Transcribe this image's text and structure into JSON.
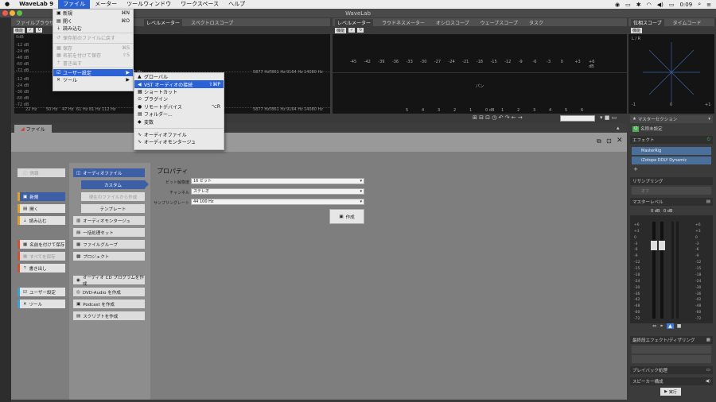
{
  "menubar": {
    "app": "WaveLab 9",
    "items": [
      "ファイル",
      "メーター",
      "ツールウィンドウ",
      "ワークスペース",
      "ヘルプ"
    ],
    "active": "ファイル",
    "time": "0:09"
  },
  "window": {
    "title": "WaveLab"
  },
  "panels": {
    "left_tabs": [
      "ファイルブラウザー",
      "レベルメーター",
      "スペクトロスコープ"
    ],
    "center_tabs": [
      "レベルメーター",
      "ラウドネスメーター",
      "オシロスコープ",
      "ウェーブスコープ",
      "タスク"
    ],
    "right_tabs": [
      "位相スコープ",
      "タイムコード"
    ],
    "mode_label": "機能",
    "phase_label": "L / R",
    "phase_scale": [
      "-1",
      "0",
      "+1"
    ]
  },
  "spectro": {
    "db_labels": [
      "0dB",
      "-12 dB",
      "-24 dB",
      "-48 dB",
      "-60 dB",
      "-72 dB",
      "-84 dB"
    ],
    "hz_labels": [
      "22 Hz",
      "31 Hz",
      "50 Hz",
      "1 Hz",
      "89 Hz",
      "112 Hz",
      "2 Hz",
      "3Hz",
      "23 Hz",
      "2 Hz",
      "4 Hz",
      "5877 Hz",
      "7861 Hz",
      "9164 Hz",
      "14080 Hz"
    ],
    "db_labels2": [
      "0dB",
      "-12 dB",
      "-24 dB",
      "-36 dB",
      "-48 dB",
      "-60 dB",
      "-72 dB",
      "-84 dB"
    ],
    "hz_labels2": [
      "22 Hz",
      "31 Hz",
      "50 Hz",
      "47 Hz",
      "61 Hz",
      "81 Hz",
      "112 Hz",
      "153 Hz",
      "2 Hz",
      "3 Hz",
      "4 Hz",
      "5877 Hz",
      "7861 Hz",
      "9164 Hz",
      "14080 Hz"
    ]
  },
  "level_meter": {
    "scale": [
      "-45",
      "-42",
      "-39",
      "-36",
      "-33",
      "-30",
      "-27",
      "-24",
      "-21",
      "-18",
      "-15",
      "-12",
      "-9",
      "-6",
      "-3",
      "0",
      "+3",
      "+6 dB"
    ],
    "pan_label": "パン",
    "pan_scale": [
      "5",
      "4",
      "3",
      "2",
      "1",
      "0 dB",
      "1",
      "2",
      "3",
      "4",
      "5",
      "6"
    ]
  },
  "file_menu": {
    "items": [
      {
        "icon": "new",
        "label": "新規",
        "shortcut": "⌘N",
        "disabled": false
      },
      {
        "icon": "open",
        "label": "開く",
        "shortcut": "⌘O",
        "disabled": false
      },
      {
        "icon": "import",
        "label": "読み込む",
        "shortcut": "",
        "disabled": false
      },
      {
        "icon": "revert",
        "label": "保存前のファイルに戻す",
        "shortcut": "",
        "disabled": true
      },
      {
        "icon": "save",
        "label": "保存",
        "shortcut": "⌘S",
        "disabled": true
      },
      {
        "icon": "saveas",
        "label": "名前を付けて保存",
        "shortcut": "⇧S",
        "disabled": true
      },
      {
        "icon": "export",
        "label": "書き出す",
        "shortcut": "",
        "disabled": true
      },
      {
        "icon": "prefs",
        "label": "ユーザー設定",
        "shortcut": "▶",
        "disabled": false,
        "highlight": true
      },
      {
        "icon": "tools",
        "label": "ツール",
        "shortcut": "▶",
        "disabled": false
      }
    ]
  },
  "prefs_submenu": {
    "items": [
      {
        "label": "グローバル",
        "shortcut": ""
      },
      {
        "label": "VST オーディオの接続",
        "shortcut": "⇧⌘P",
        "highlight": true
      },
      {
        "label": "ショートカット",
        "shortcut": ""
      },
      {
        "label": "プラグイン",
        "shortcut": ""
      },
      {
        "label": "リモートデバイス",
        "shortcut": "⌥R"
      },
      {
        "label": "フォルダー...",
        "shortcut": ""
      },
      {
        "label": "変数",
        "shortcut": ""
      },
      {
        "label": "オーディオファイル",
        "shortcut": ""
      },
      {
        "label": "オーディオモンタージュ",
        "shortcut": ""
      }
    ]
  },
  "file_tab": {
    "label": "ファイル"
  },
  "left_nav": {
    "items": [
      {
        "label": "情報",
        "disabled": true,
        "color": ""
      },
      {
        "label": "新規",
        "selected": true,
        "color": "#e0a020"
      },
      {
        "label": "開く",
        "color": "#e0a020"
      },
      {
        "label": "読み込む",
        "color": "#e0a020"
      },
      {
        "label": "名前を付けて保存",
        "color": "#d05030"
      },
      {
        "label": "すべてを保存",
        "disabled": true,
        "color": "#d05030"
      },
      {
        "label": "書き出し",
        "color": "#d05030"
      },
      {
        "label": "ユーザー設定",
        "color": "#3aa0d0"
      },
      {
        "label": "ツール",
        "color": "#3aa0d0"
      }
    ]
  },
  "mid_nav": {
    "audio_file": "オーディオファイル",
    "custom": "カスタム",
    "from_current": "現在のファイルから作成",
    "template": "テンプレート",
    "montage": "オーディオモンタージュ",
    "batch": "一括処理セット",
    "file_group": "ファイルグループ",
    "project": "プロジェクト",
    "cd": "オーディオ CD プログラムを作成",
    "dvd": "DVD-Audio を作成",
    "podcast": "Podcast を作成",
    "script": "スクリプトを作成"
  },
  "properties": {
    "title": "プロパティ",
    "bit_label": "ビット解像度",
    "bit_value": "16 ビット",
    "channel_label": "チャンネル",
    "channel_value": "ステレオ",
    "rate_label": "サンプリングレート",
    "rate_value": "44 100 Hz",
    "create_button": "作成"
  },
  "master": {
    "header": "マスターセクション",
    "unsaved": "名称未設定",
    "effects": "エフェクト",
    "plugins": [
      "MasterRig",
      "iZotope DDLY Dynamic"
    ],
    "resampling": "リサンプリング",
    "resample_value": "オフ",
    "master_level": "マスターレベル",
    "level_values": [
      "0 dB",
      "0 dB"
    ],
    "fader_scale": [
      "+6",
      "+3",
      "0",
      "-3",
      "-6",
      "-9",
      "-12",
      "-15",
      "-18",
      "-24",
      "-30",
      "-36",
      "-42",
      "-48",
      "-60",
      "-72"
    ],
    "final_effects": "最終段エフェクト/ディザリング",
    "playback": "プレイバック処理",
    "speaker": "スピーカー構成",
    "render": "実行"
  },
  "colors": {
    "accent": "#2b63d6",
    "nav_selected": "#3d5fa5",
    "power_green": "#4caf50"
  }
}
